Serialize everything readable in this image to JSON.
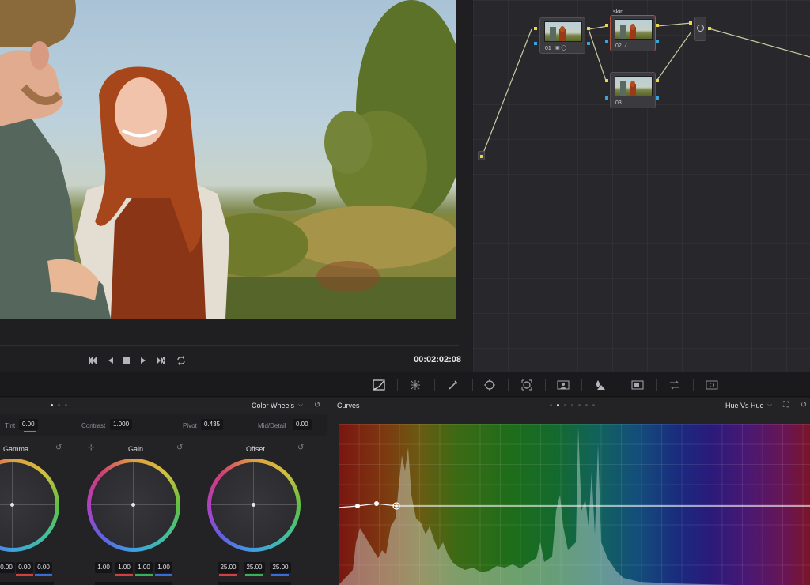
{
  "viewer": {
    "timecode": "00:02:02:08",
    "transport": [
      "jump-to-start",
      "play-reverse",
      "stop",
      "play-forward",
      "jump-to-end",
      "loop"
    ]
  },
  "node_graph": {
    "nodes": [
      {
        "label": "01",
        "title": ""
      },
      {
        "label": "02",
        "title": "skin"
      },
      {
        "label": "03",
        "title": ""
      }
    ],
    "colors": {
      "input_port": "#e5d84a",
      "output_port": "#3aa4d8",
      "selected_border": "#b05040"
    }
  },
  "toolbar": {
    "tools": [
      "curves-icon",
      "warper-icon",
      "qualifier-icon",
      "power-window-icon",
      "tracker-icon",
      "magic-mask-icon",
      "blur-icon",
      "key-icon",
      "sizing-icon",
      "3d-icon"
    ]
  },
  "wheels": {
    "mode": "Color Wheels",
    "adjust": {
      "tint_label": "Tint",
      "tint": "0.00",
      "contrast_label": "Contrast",
      "contrast": "1.000",
      "pivot_label": "Pivot",
      "pivot": "0.435",
      "middetail_label": "Mid/Detail",
      "middetail": "0.00"
    },
    "gamma": {
      "title": "Gamma",
      "values": [
        "0.00",
        "0.00",
        "0.00"
      ]
    },
    "gain": {
      "title": "Gain",
      "values": [
        "1.00",
        "1.00",
        "1.00",
        "1.00"
      ]
    },
    "offset": {
      "title": "Offset",
      "values": [
        "25.00",
        "25.00",
        "25.00"
      ]
    }
  },
  "curves": {
    "title": "Curves",
    "mode": "Hue Vs Hue"
  }
}
